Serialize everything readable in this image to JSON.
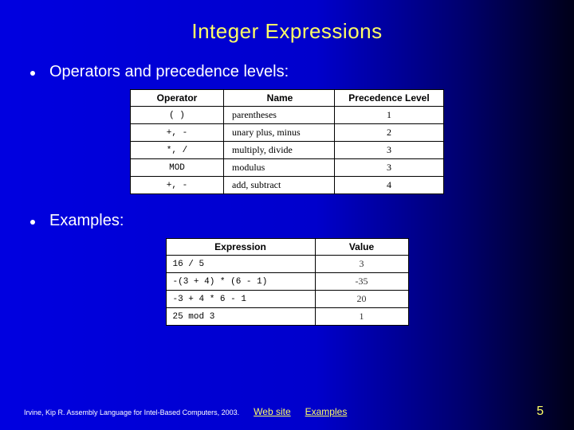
{
  "title": "Integer Expressions",
  "bullets": {
    "b1": "Operators and precedence levels:",
    "b2": "Examples:"
  },
  "table1": {
    "headers": {
      "c1": "Operator",
      "c2": "Name",
      "c3": "Precedence Level"
    },
    "rows": [
      {
        "op": "( )",
        "name": "parentheses",
        "prec": "1"
      },
      {
        "op": "+, -",
        "name": "unary plus, minus",
        "prec": "2"
      },
      {
        "op": "*, /",
        "name": "multiply, divide",
        "prec": "3"
      },
      {
        "op": "MOD",
        "name": "modulus",
        "prec": "3"
      },
      {
        "op": "+, -",
        "name": "add, subtract",
        "prec": "4"
      }
    ]
  },
  "table2": {
    "headers": {
      "c1": "Expression",
      "c2": "Value"
    },
    "rows": [
      {
        "expr": "16 / 5",
        "val": "3"
      },
      {
        "expr": "-(3 + 4) * (6 - 1)",
        "val": "-35"
      },
      {
        "expr": "-3 + 4 * 6 - 1",
        "val": "20"
      },
      {
        "expr": "25 mod 3",
        "val": "1"
      }
    ]
  },
  "footer": {
    "cite": "Irvine, Kip R. Assembly Language for Intel-Based Computers, 2003.",
    "link1": "Web site",
    "link2": "Examples",
    "page": "5"
  }
}
